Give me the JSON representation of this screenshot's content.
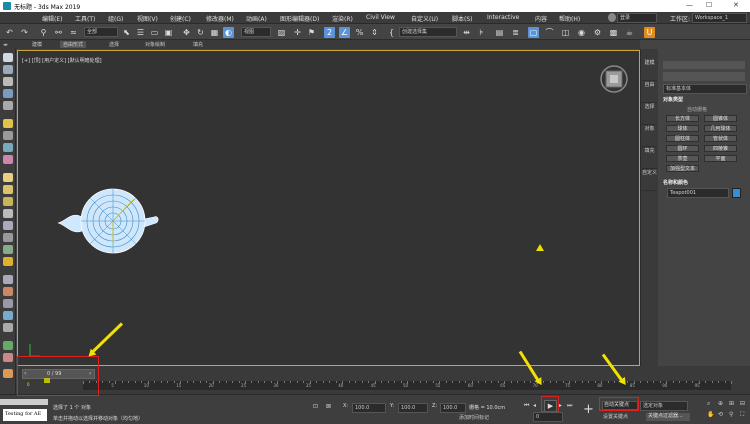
{
  "title": "无标题 - 3ds Max 2019",
  "window_controls": [
    "—",
    "☐",
    "✕"
  ],
  "menu": [
    "编辑(E)",
    "工具(T)",
    "组(G)",
    "视图(V)",
    "创建(C)",
    "修改器(M)",
    "动画(A)",
    "图形编辑器(D)",
    "渲染(R)",
    "Civil View",
    "自定义(U)",
    "脚本(S)",
    "Interactive",
    "内容",
    "帮助(H)"
  ],
  "user": {
    "label": "登录",
    "workspace_label": "工作区:",
    "workspace": "Workspace_1"
  },
  "toolbar": {
    "filter": "全部",
    "view_dropdown": "视图",
    "selection_set": "创建选择集"
  },
  "ribbon_tabs": [
    "建模",
    "自由形式",
    "选择",
    "对象绘制",
    "填充"
  ],
  "viewport_label": "[+] [顶] [用户定义] [默认明暗处理]",
  "side_tabs": [
    "建模",
    "自由",
    "选择",
    "对象",
    "填充",
    "自定义"
  ],
  "command_panel": {
    "category": "标准基本体",
    "object_type_title": "对象类型",
    "autogrid": "自动栅格",
    "buttons": [
      "长方体",
      "圆锥体",
      "球体",
      "几何球体",
      "圆柱体",
      "管状体",
      "圆环",
      "四棱锥",
      "茶壶",
      "平面",
      "加强型文本"
    ],
    "name_color_title": "名称和颜色",
    "object_name": "Teapot001",
    "color": "#3a8ed0"
  },
  "timeline": {
    "frame": "0 / 99",
    "ticks": [
      "0",
      "5",
      "10",
      "15",
      "20",
      "25",
      "30",
      "35",
      "40",
      "45",
      "50",
      "55",
      "60",
      "65",
      "70",
      "75",
      "80",
      "85",
      "90",
      "95"
    ]
  },
  "status": {
    "script_box": "Testing for AE",
    "selected": "选择了 1 个 对象",
    "hint": "单击并拖动以选择并移动对象（均匀地）",
    "x_label": "X:",
    "x": "100.0",
    "y_label": "Y:",
    "y": "100.0",
    "z_label": "Z:",
    "z": "100.0",
    "grid": "栅格 = 10.0cm",
    "add_time_tag": "添加时间标记",
    "current_frame": "0",
    "auto_key": "自动关键点",
    "selected_object": "选定对象",
    "set_key": "设置关键点",
    "key_filters": "关键点过滤器..."
  }
}
